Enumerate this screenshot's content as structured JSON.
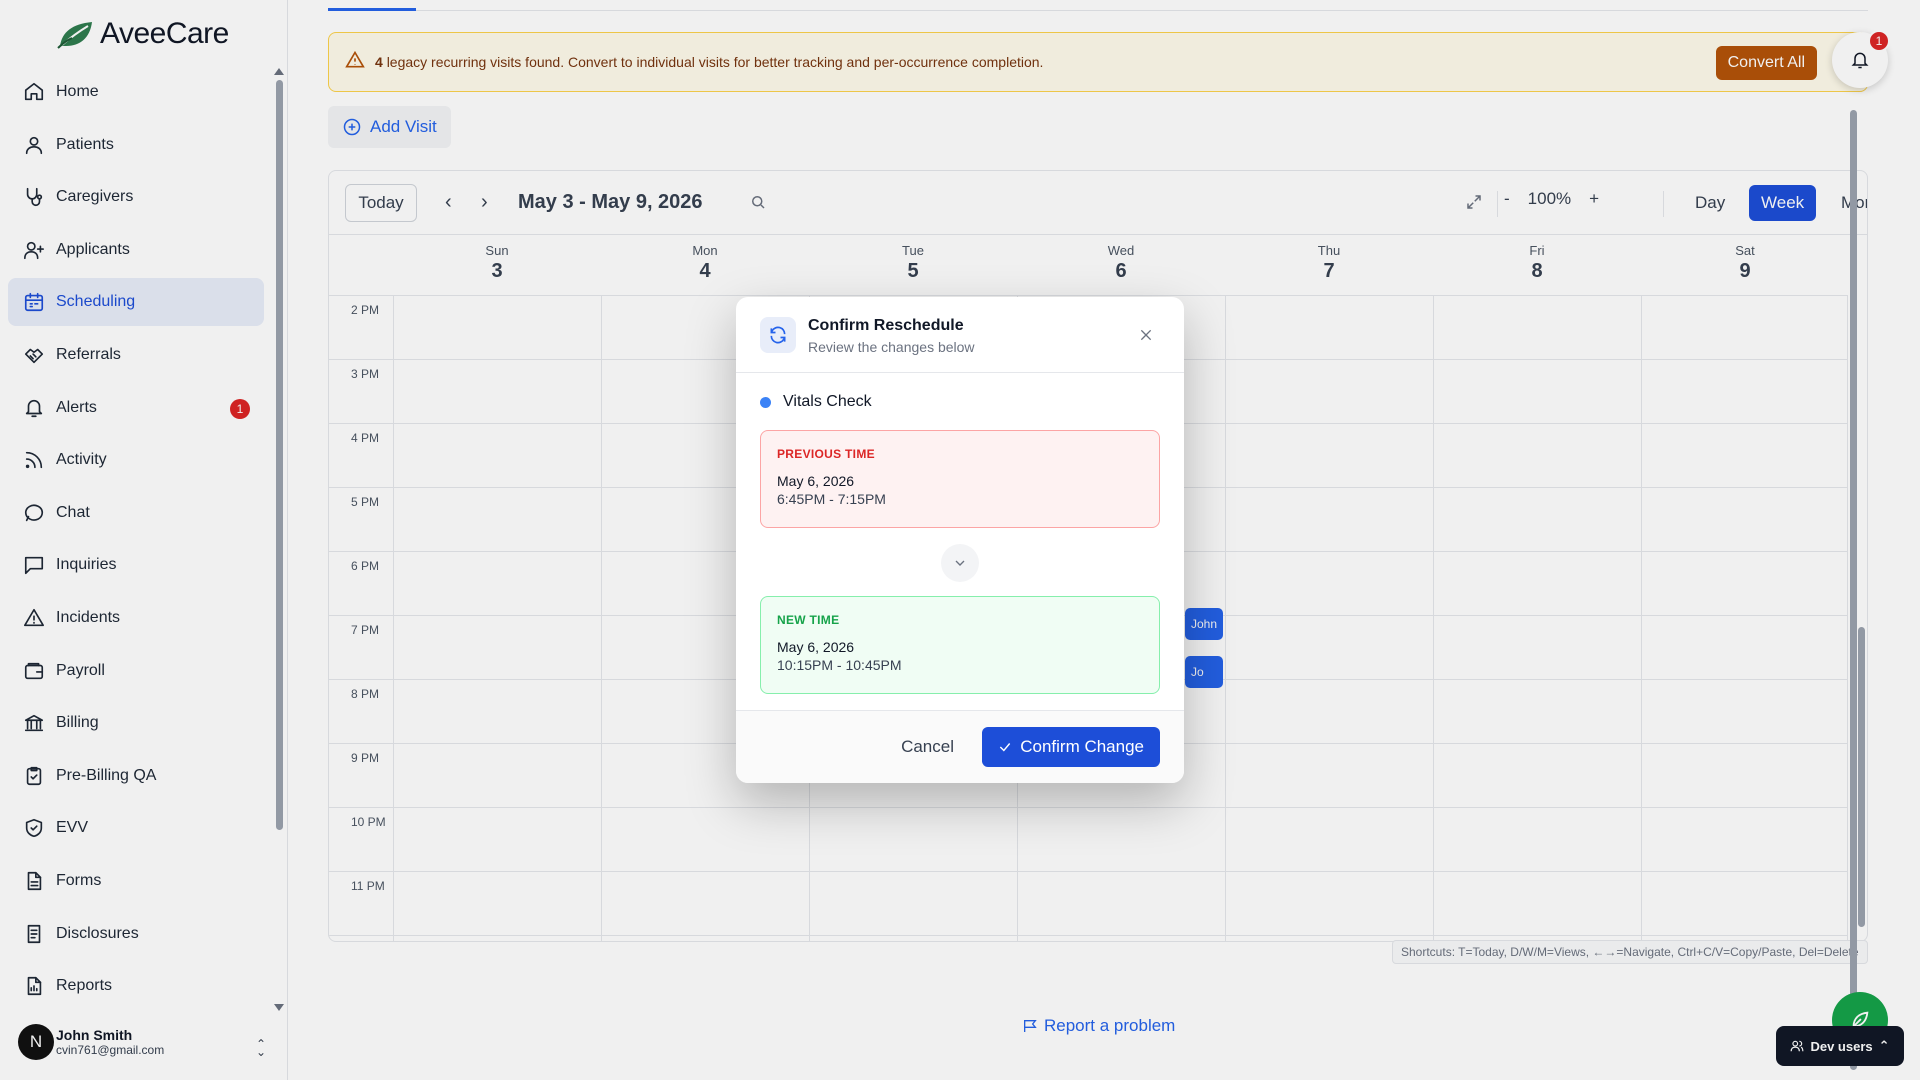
{
  "app": {
    "name": "AveeCare"
  },
  "sidebar": {
    "items": [
      {
        "label": "Home",
        "icon": "home-icon"
      },
      {
        "label": "Patients",
        "icon": "user-icon"
      },
      {
        "label": "Caregivers",
        "icon": "stethoscope-icon"
      },
      {
        "label": "Applicants",
        "icon": "user-plus-icon"
      },
      {
        "label": "Scheduling",
        "icon": "calendar-icon",
        "active": true
      },
      {
        "label": "Referrals",
        "icon": "handshake-icon"
      },
      {
        "label": "Alerts",
        "icon": "bell-icon",
        "badge": "1"
      },
      {
        "label": "Activity",
        "icon": "rss-icon"
      },
      {
        "label": "Chat",
        "icon": "chat-icon"
      },
      {
        "label": "Inquiries",
        "icon": "message-square-icon"
      },
      {
        "label": "Incidents",
        "icon": "warning-icon"
      },
      {
        "label": "Payroll",
        "icon": "wallet-icon"
      },
      {
        "label": "Billing",
        "icon": "bank-icon"
      },
      {
        "label": "Pre-Billing QA",
        "icon": "clipboard-check-icon"
      },
      {
        "label": "EVV",
        "icon": "shield-check-icon"
      },
      {
        "label": "Forms",
        "icon": "file-icon"
      },
      {
        "label": "Disclosures",
        "icon": "file-text-icon"
      },
      {
        "label": "Reports",
        "icon": "report-icon"
      }
    ]
  },
  "user": {
    "initial": "N",
    "name": "John Smith",
    "email": "cvin761@gmail.com"
  },
  "banner": {
    "count": "4",
    "text": "legacy recurring visits found. Convert to individual visits for better tracking and per-occurrence completion.",
    "action": "Convert All"
  },
  "notifications": {
    "count": "1"
  },
  "toolbar": {
    "add_visit": "Add Visit"
  },
  "calendar": {
    "today": "Today",
    "range": "May 3 - May 9, 2026",
    "zoom_minus": "-",
    "zoom": "100%",
    "zoom_plus": "+",
    "views": {
      "day": "Day",
      "week": "Week",
      "month": "Month"
    },
    "days": [
      {
        "name": "Sun",
        "date": "3"
      },
      {
        "name": "Mon",
        "date": "4"
      },
      {
        "name": "Tue",
        "date": "5"
      },
      {
        "name": "Wed",
        "date": "6"
      },
      {
        "name": "Thu",
        "date": "7"
      },
      {
        "name": "Fri",
        "date": "8"
      },
      {
        "name": "Sat",
        "date": "9"
      }
    ],
    "hours": [
      "2 PM",
      "3 PM",
      "4 PM",
      "5 PM",
      "6 PM",
      "7 PM",
      "8 PM",
      "9 PM",
      "10 PM",
      "11 PM"
    ],
    "events": [
      {
        "label": "John"
      },
      {
        "label": "Jo"
      }
    ],
    "shortcuts": "Shortcuts: T=Today, D/W/M=Views, ←→=Navigate, Ctrl+C/V=Copy/Paste, Del=Delete"
  },
  "footer": {
    "report": "Report a problem",
    "dev_users": "Dev users"
  },
  "modal": {
    "title": "Confirm Reschedule",
    "subtitle": "Review the changes below",
    "visit_name": "Vitals Check",
    "previous": {
      "caption": "PREVIOUS TIME",
      "date": "May 6, 2026",
      "time": "6:45PM - 7:15PM"
    },
    "new": {
      "caption": "NEW TIME",
      "date": "May 6, 2026",
      "time": "10:15PM - 10:45PM"
    },
    "cancel": "Cancel",
    "confirm": "Confirm Change"
  },
  "colors": {
    "primary": "#1d4ed8",
    "warning": "#b45309",
    "danger": "#dc2626",
    "success": "#16a34a"
  }
}
